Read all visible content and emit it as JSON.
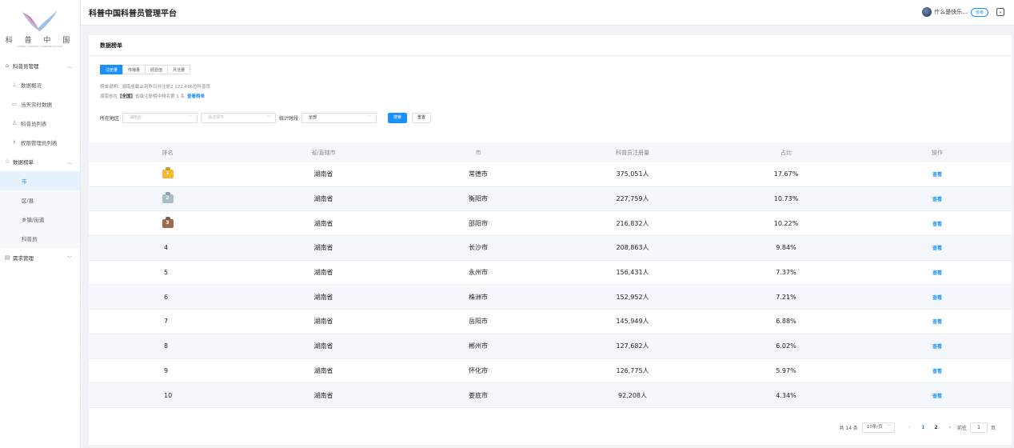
{
  "logo": {
    "text": "科 普 中 国",
    "sub": "CHINA SCIENCE COMMUNICATION"
  },
  "sidebar": {
    "groups": [
      {
        "label": "科普员管理",
        "icon": "home-icon",
        "items": [
          {
            "label": "数据概况",
            "icon": "chart-icon"
          },
          {
            "label": "当天实时数据",
            "icon": "monitor-icon"
          },
          {
            "label": "科普员列表",
            "icon": "user-icon"
          },
          {
            "label": "权限管理员列表",
            "icon": "admin-icon"
          }
        ]
      },
      {
        "label": "数据榜单",
        "icon": "star-icon",
        "items": [
          {
            "label": "市",
            "active": true
          },
          {
            "label": "区/县"
          },
          {
            "label": "乡镇/街道"
          },
          {
            "label": "科普员"
          }
        ]
      },
      {
        "label": "需求管理",
        "icon": "document-icon",
        "items": []
      }
    ]
  },
  "header": {
    "title": "科普中国科普员管理平台",
    "username": "什么是快乐...",
    "role": "省级"
  },
  "card": {
    "title": "数据榜单",
    "tabs": [
      {
        "label": "注册量",
        "active": true
      },
      {
        "label": "传播量"
      },
      {
        "label": "经验值"
      },
      {
        "label": "月活量"
      }
    ],
    "desc1": "榜单说明：湖南省截止到昨日共注册2,122,496位科普员",
    "desc2_prefix": "湖南省在",
    "desc2_bold": "【全国】",
    "desc2_suffix": "省级注册榜中排名第 1 名",
    "desc2_link": "查看榜单"
  },
  "filters": {
    "region_label": "所在地区",
    "province_placeholder": "湖南省",
    "city_placeholder": "请选择市",
    "time_label": "统计时段",
    "time_value": "全部",
    "search_label": "搜索",
    "reset_label": "重置"
  },
  "table": {
    "headers": [
      "排名",
      "省/直辖市",
      "市",
      "科普员注册量",
      "占比",
      "操作"
    ],
    "action_label": "查看",
    "rows": [
      {
        "rank": "1",
        "province": "湖南省",
        "city": "常德市",
        "count": "375,051人",
        "ratio": "17.67%"
      },
      {
        "rank": "2",
        "province": "湖南省",
        "city": "衡阳市",
        "count": "227,759人",
        "ratio": "10.73%"
      },
      {
        "rank": "3",
        "province": "湖南省",
        "city": "邵阳市",
        "count": "216,832人",
        "ratio": "10.22%"
      },
      {
        "rank": "4",
        "province": "湖南省",
        "city": "长沙市",
        "count": "208,863人",
        "ratio": "9.84%"
      },
      {
        "rank": "5",
        "province": "湖南省",
        "city": "永州市",
        "count": "156,431人",
        "ratio": "7.37%"
      },
      {
        "rank": "6",
        "province": "湖南省",
        "city": "株洲市",
        "count": "152,952人",
        "ratio": "7.21%"
      },
      {
        "rank": "7",
        "province": "湖南省",
        "city": "岳阳市",
        "count": "145,949人",
        "ratio": "6.88%"
      },
      {
        "rank": "8",
        "province": "湖南省",
        "city": "郴州市",
        "count": "127,682人",
        "ratio": "6.02%"
      },
      {
        "rank": "9",
        "province": "湖南省",
        "city": "怀化市",
        "count": "126,775人",
        "ratio": "5.97%"
      },
      {
        "rank": "10",
        "province": "湖南省",
        "city": "娄底市",
        "count": "92,208人",
        "ratio": "4.34%"
      }
    ]
  },
  "pager": {
    "total": "共 14 条",
    "page_size": "10条/页",
    "pages": [
      "1",
      "2"
    ],
    "current": "1",
    "goto_label": "前往",
    "goto_value": "1",
    "page_suffix": "页"
  }
}
